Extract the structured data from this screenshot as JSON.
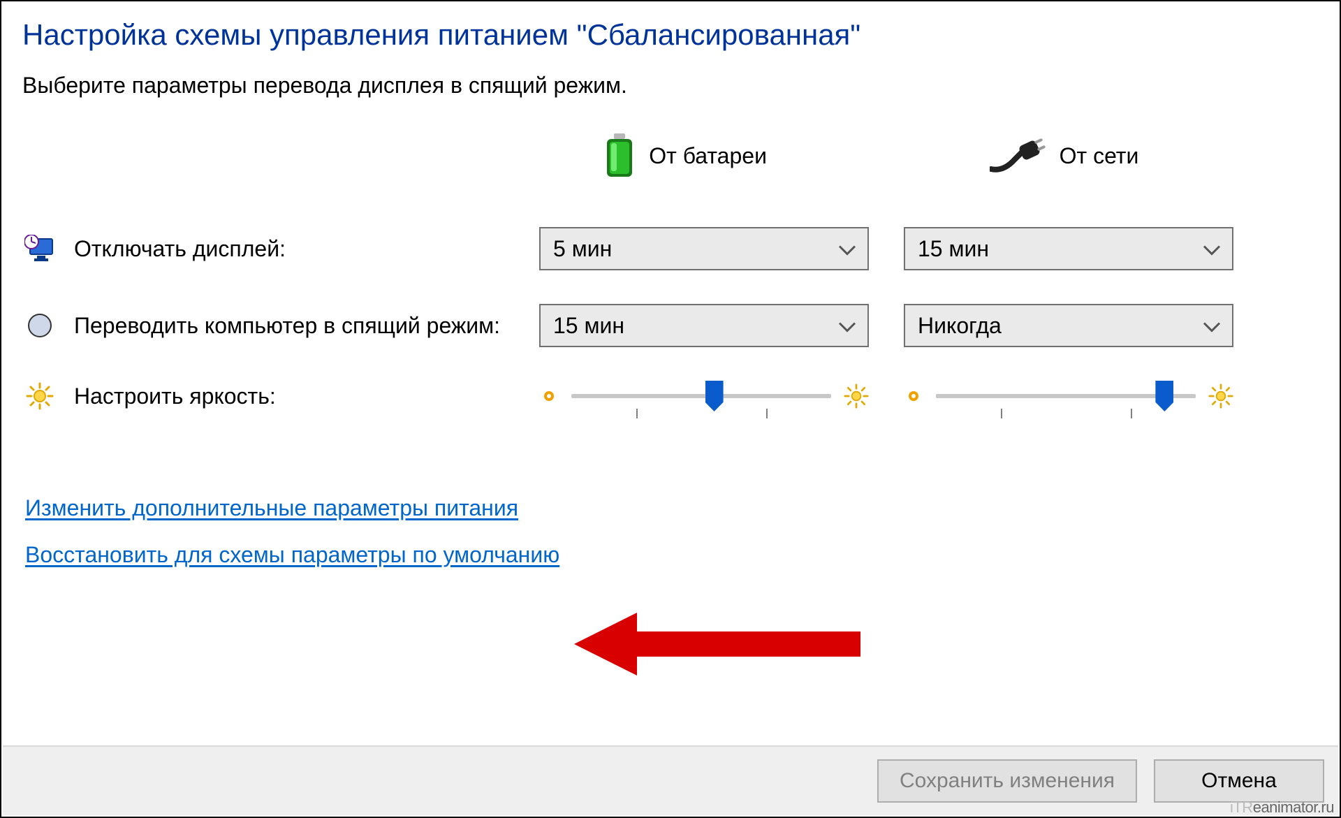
{
  "header": {
    "title": "Настройка схемы управления питанием \"Сбалансированная\"",
    "subtitle": "Выберите параметры перевода дисплея в спящий режим."
  },
  "columns": {
    "battery": "От батареи",
    "plugged": "От сети"
  },
  "rows": {
    "display_off": {
      "label": "Отключать дисплей:",
      "battery_value": "5 мин",
      "plugged_value": "15 мин"
    },
    "sleep": {
      "label": "Переводить компьютер в спящий режим:",
      "battery_value": "15 мин",
      "plugged_value": "Никогда"
    },
    "brightness": {
      "label": "Настроить яркость:",
      "battery_percent": 55,
      "plugged_percent": 88
    }
  },
  "links": {
    "advanced": "Изменить дополнительные параметры питания",
    "restore": "Восстановить для схемы параметры по умолчанию"
  },
  "footer": {
    "save": "Сохранить изменения",
    "cancel": "Отмена"
  },
  "watermark": {
    "brand": "iTR",
    "rest": "eanimator.ru"
  },
  "icons": {
    "battery": "battery-icon",
    "plug": "plug-icon",
    "monitor_clock": "monitor-clock-icon",
    "moon": "moon-icon",
    "sun": "sun-icon",
    "sun_small": "sun-small-icon",
    "sun_large": "sun-large-icon",
    "chevron": "chevron-down-icon",
    "arrow": "annotation-arrow"
  }
}
